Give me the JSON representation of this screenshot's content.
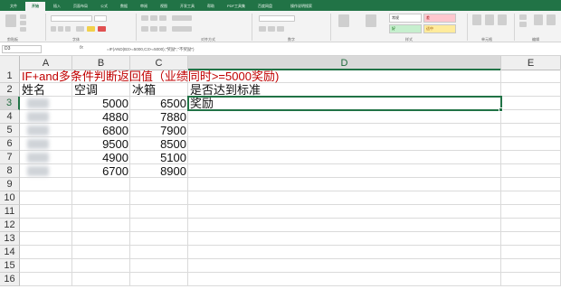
{
  "ribbon_tabs": [
    "文件",
    "开始",
    "插入",
    "页面布局",
    "公式",
    "数据",
    "审阅",
    "视图",
    "开发工具",
    "帮助",
    "PDF工具集",
    "百度网盘",
    "操作说明搜索"
  ],
  "ribbon": {
    "groups": [
      "剪贴板",
      "字体",
      "对齐方式",
      "数字",
      "样式",
      "单元格",
      "编辑"
    ],
    "style_cells": [
      "常规",
      "差",
      "好",
      "适中"
    ]
  },
  "formula_bar": {
    "name_box": "D3",
    "fx": "fx",
    "formula": "=IF(AND(B3>=5000,C3>=5000),\"奖励\",\"不奖励\")"
  },
  "columns": [
    "A",
    "B",
    "C",
    "D",
    "E"
  ],
  "rows": [
    "1",
    "2",
    "3",
    "4",
    "5",
    "6",
    "7",
    "8",
    "9",
    "10",
    "11",
    "12",
    "13",
    "14",
    "15",
    "16"
  ],
  "sheet": {
    "title": "IF+and多条件判断返回值（业绩同时>=5000奖励)",
    "headers": [
      "姓名",
      "空调",
      "冰箱",
      "是否达到标准"
    ],
    "data": [
      {
        "ac": "5000",
        "fridge": "6500",
        "result": "奖励"
      },
      {
        "ac": "4880",
        "fridge": "7880",
        "result": ""
      },
      {
        "ac": "6800",
        "fridge": "7900",
        "result": ""
      },
      {
        "ac": "9500",
        "fridge": "8500",
        "result": ""
      },
      {
        "ac": "4900",
        "fridge": "5100",
        "result": ""
      },
      {
        "ac": "6700",
        "fridge": "8900",
        "result": ""
      }
    ]
  },
  "colors": {
    "accent": "#217346",
    "title_text": "#c00000"
  }
}
